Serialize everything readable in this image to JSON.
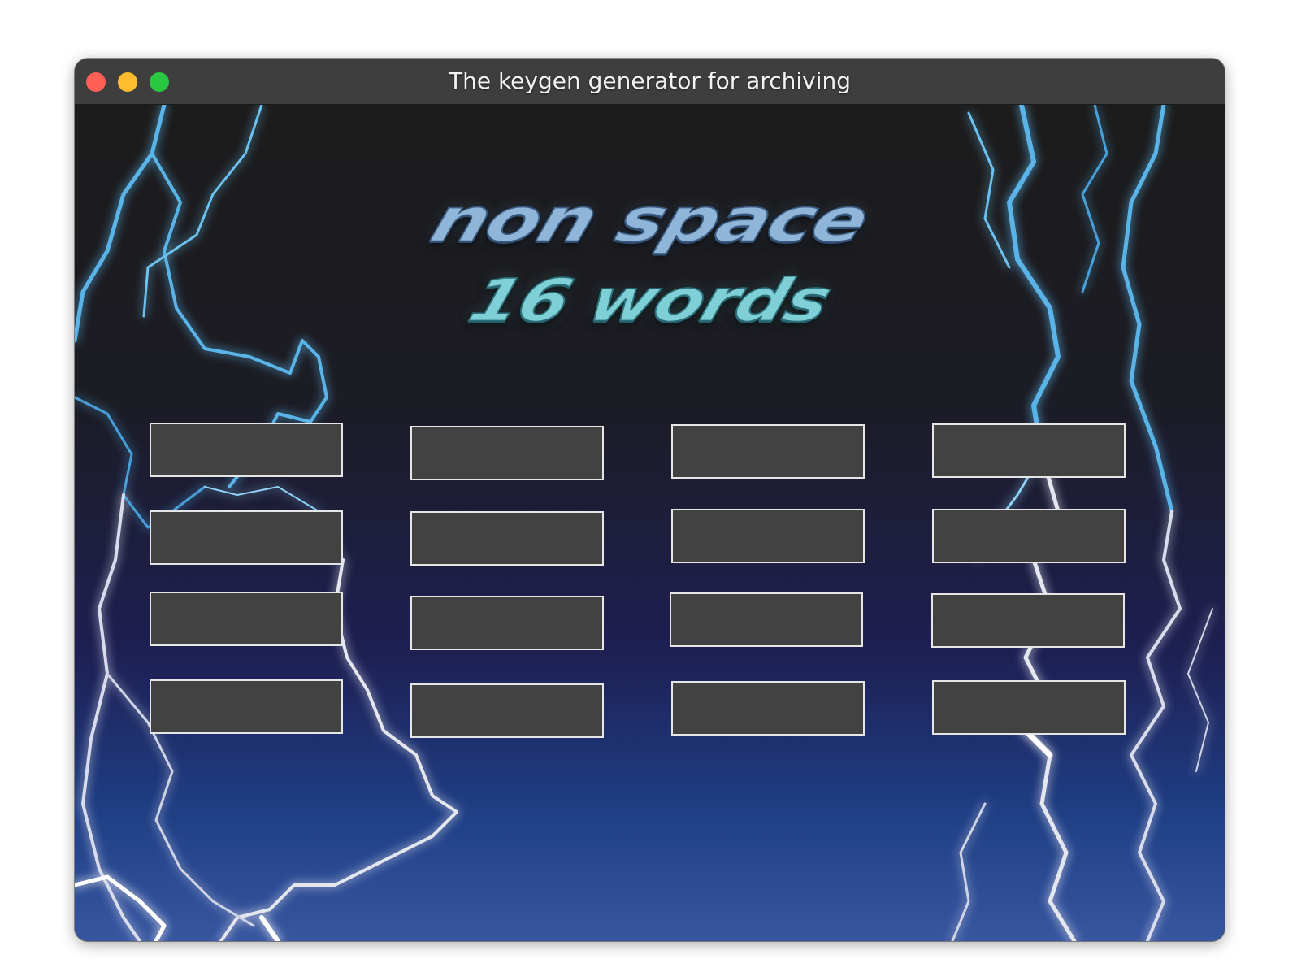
{
  "window": {
    "title": "The keygen generator for archiving"
  },
  "logo": {
    "line1": "non space",
    "line2": "16 words"
  },
  "word_fields": [
    {
      "value": ""
    },
    {
      "value": ""
    },
    {
      "value": ""
    },
    {
      "value": ""
    },
    {
      "value": ""
    },
    {
      "value": ""
    },
    {
      "value": ""
    },
    {
      "value": ""
    },
    {
      "value": ""
    },
    {
      "value": ""
    },
    {
      "value": ""
    },
    {
      "value": ""
    },
    {
      "value": ""
    },
    {
      "value": ""
    },
    {
      "value": ""
    },
    {
      "value": ""
    }
  ],
  "colors": {
    "titlebar": "#3e3e3e",
    "field_background": "#424242",
    "field_border": "#e6e6e6",
    "lightning": "#5ab4e8"
  }
}
